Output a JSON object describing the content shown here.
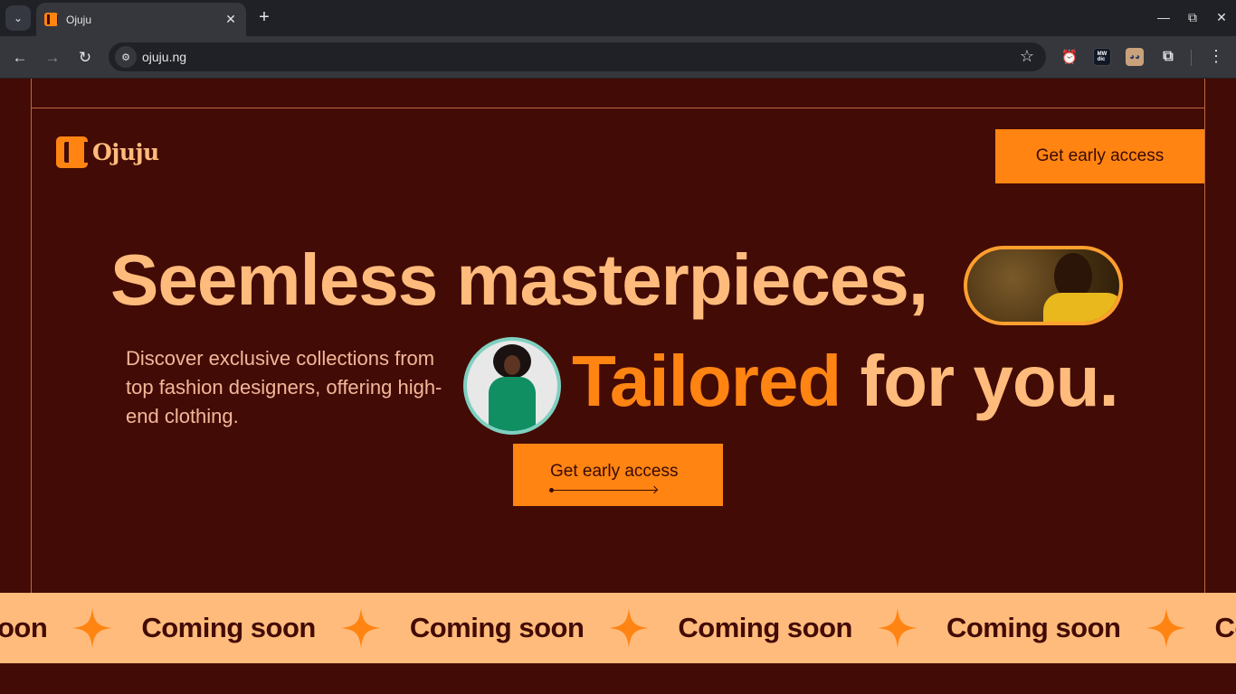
{
  "browser": {
    "tab_title": "Ojuju",
    "url": "ojuju.ng",
    "icons": [
      "tab-search-icon",
      "close-icon",
      "new-tab-icon",
      "minimize-icon",
      "restore-icon",
      "window-close-icon",
      "back-icon",
      "forward-icon",
      "reload-icon",
      "site-info-icon",
      "bookmark-star-icon",
      "alarm-extension-icon",
      "merriam-webster-extension-icon",
      "face-extension-icon",
      "extensions-puzzle-icon",
      "menu-kebab-icon"
    ]
  },
  "header": {
    "logo_text": "Ojuju",
    "cta_label": "Get early access"
  },
  "hero": {
    "headline_line1": "Seemless masterpieces,",
    "headline_accent": "Tailored",
    "headline_rest": " for you.",
    "subtext": "Discover exclusive collections from top fashion designers, offering high-end clothing.",
    "cta_label": "Get early access"
  },
  "marquee": {
    "items": [
      "oon",
      "Coming soon",
      "Coming soon",
      "Coming soon",
      "Coming soon",
      "Coming so"
    ]
  },
  "colors": {
    "background": "#430b05",
    "accent": "#ff8412",
    "peach": "#ffbb7c"
  }
}
